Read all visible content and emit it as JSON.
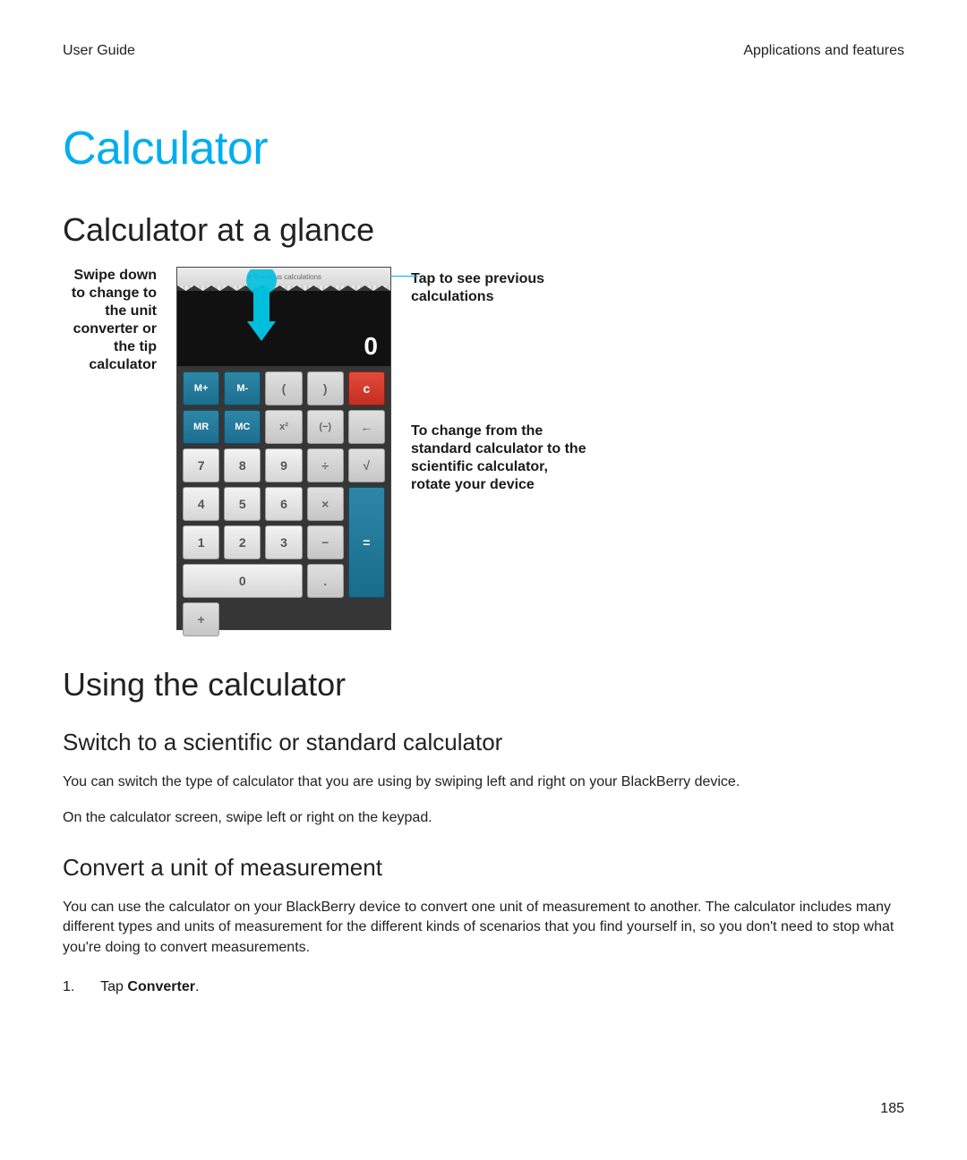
{
  "header": {
    "left": "User Guide",
    "right": "Applications and features"
  },
  "title": "Calculator",
  "section1": "Calculator at a glance",
  "diagram": {
    "left_label": "Swipe down to change to the unit converter or the tip calculator",
    "right_label_1": "Tap to see previous calculations",
    "right_label_2": "To change from the standard calculator to the scientific calculator, rotate your device",
    "prev_text": "⇕ Previous calculations",
    "display_value": "0",
    "keys": {
      "mplus": "M+",
      "mminus": "M-",
      "lpar": "(",
      "rpar": ")",
      "clear": "c",
      "mr": "MR",
      "mc": "MC",
      "sq": "x²",
      "neg": "(−)",
      "back": "←",
      "k7": "7",
      "k8": "8",
      "k9": "9",
      "div": "÷",
      "sqrt": "√",
      "k4": "4",
      "k5": "5",
      "k6": "6",
      "mul": "×",
      "k1": "1",
      "k2": "2",
      "k3": "3",
      "sub": "−",
      "eq": "=",
      "k0": "0",
      "dot": ".",
      "add": "+"
    }
  },
  "section2": "Using the calculator",
  "subsection1": "Switch to a scientific or standard calculator",
  "para1": "You can switch the type of calculator that you are using by swiping left and right on your BlackBerry device.",
  "para2": "On the calculator screen, swipe left or right on the keypad.",
  "subsection2": "Convert a unit of measurement",
  "para3": "You can use the calculator on your BlackBerry device to convert one unit of measurement to another. The calculator includes many different types and units of measurement for the different kinds of scenarios that you find yourself in, so you don't need to stop what you're doing to convert measurements.",
  "step1_num": "1.",
  "step1_pre": "Tap ",
  "step1_bold": "Converter",
  "step1_post": ".",
  "page_number": "185"
}
